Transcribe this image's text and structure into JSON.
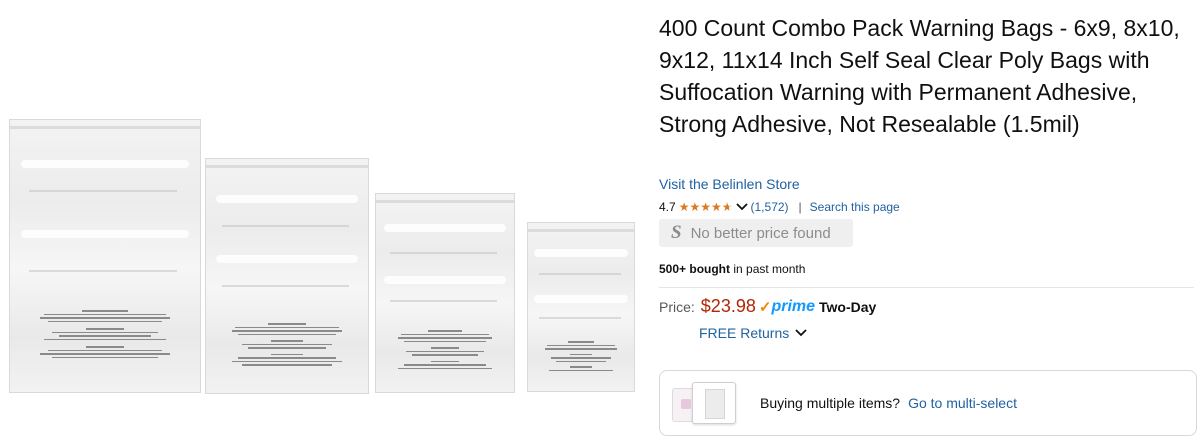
{
  "product": {
    "title": "400 Count Combo Pack Warning Bags - 6x9, 8x10, 9x12, 11x14 Inch Self Seal Clear Poly Bags with Suffocation Warning with Permanent Adhesive, Strong Adhesive, Not Resealable (1.5mil)",
    "store_link": "Visit the Belinlen Store",
    "image_icon": "clear-poly-bags-image"
  },
  "rating": {
    "value": "4.7",
    "stars_out_of_5": 4.7,
    "review_count": "(1,572)",
    "separator": "|",
    "search_page_link": "Search this page"
  },
  "badge": {
    "icon": "S",
    "text": "No better price found"
  },
  "bought": {
    "bold": "500+ bought",
    "rest": " in past month"
  },
  "price": {
    "label": "Price:",
    "amount": "$23.98",
    "prime_check": "✓",
    "prime_word": "prime",
    "delivery": "Two-Day",
    "returns_link": "FREE Returns"
  },
  "multi_select": {
    "text": "Buying multiple items?",
    "link": "Go to multi-select"
  },
  "colors": {
    "link": "#2162a1",
    "price": "#b12704",
    "star": "#de7921",
    "prime": "#1399ff"
  }
}
